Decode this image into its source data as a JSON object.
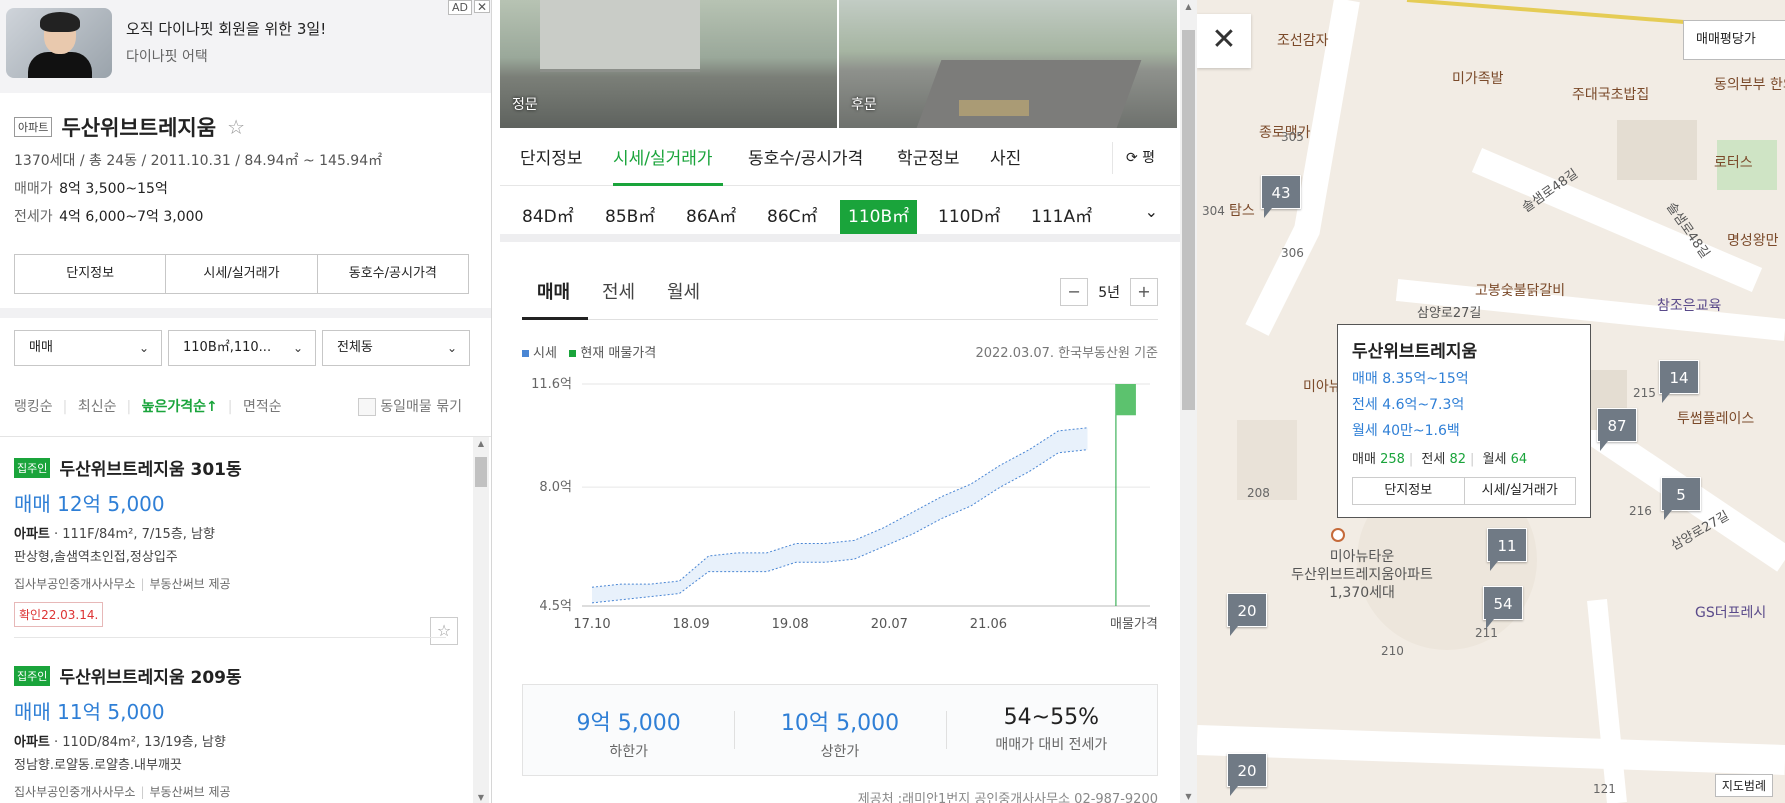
{
  "ad": {
    "badge": "AD",
    "close": "✕",
    "title": "오직 다이나핏 회원을 위한 3일!",
    "subtitle": "다이나핏 어택"
  },
  "complex": {
    "type": "아파트",
    "name": "두산위브트레지움",
    "star": "☆",
    "meta": "1370세대 / 총 24동 / 2011.10.31 / 84.94㎡ ~ 145.94㎡",
    "sale_label": "매매가",
    "sale_value": "8억 3,500~15억",
    "jeonse_label": "전세가",
    "jeonse_value": "4억 6,000~7억 3,000"
  },
  "left_tabs": [
    "단지정보",
    "시세/실거래가",
    "동호수/공시가격"
  ],
  "filters": {
    "trade": "매매",
    "size": "110B㎡,110...",
    "dong": "전체동",
    "chev": "⌄"
  },
  "sorts": {
    "s1": "랭킹순",
    "s2": "최신순",
    "s3": "높은가격순↑",
    "s4": "면적순",
    "same": "동일매물 묶기"
  },
  "listings": [
    {
      "owner": "집주인",
      "name": "두산위브트레지움 301동",
      "price": "매매 12억 5,000",
      "spec_type": "아파트",
      "spec": " · 111F/84m², 7/15층, 남향",
      "desc": "판상형,솔샘역초인접,정상입주",
      "agent": "집사부공인중개사사무소",
      "provider": "부동산써브 제공",
      "confirm": "확인22.03.14.",
      "fav": "☆"
    },
    {
      "owner": "집주인",
      "name": "두산위브트레지움 209동",
      "price": "매매 11억 5,000",
      "spec_type": "아파트",
      "spec": " · 110D/84m², 13/19층, 남향",
      "desc": "정남향.로얄동.로얄층.내부깨끗",
      "agent": "집사부공인중개사사무소",
      "provider": "부동산써브 제공"
    }
  ],
  "photos": {
    "front": "정문",
    "back": "후문"
  },
  "main_tabs": [
    "단지정보",
    "시세/실거래가",
    "동호수/공시가격",
    "학군정보",
    "사진"
  ],
  "pyeong": "평",
  "sizes": [
    "84D㎡",
    "85B㎡",
    "86A㎡",
    "86C㎡",
    "110B㎡",
    "110D㎡",
    "111A㎡"
  ],
  "size_more": "⌄",
  "sub_tabs": [
    "매매",
    "전세",
    "월세"
  ],
  "period": {
    "minus": "−",
    "value": "5년",
    "plus": "+"
  },
  "legend": {
    "a": "시세",
    "b": "현재 매물가격"
  },
  "basis": "2022.03.07. 한국부동산원 기준",
  "colors": {
    "accent": "#1aa43b",
    "blue": "#2f7fd6",
    "band": "#e8f1fb",
    "band_line": "#4a86d4"
  },
  "chart_data": {
    "type": "area",
    "y_ticks": [
      "11.6억",
      "8.0억",
      "4.5억"
    ],
    "ylim": [
      4.5,
      11.6
    ],
    "x_ticks": [
      "17.10",
      "18.09",
      "19.08",
      "20.07",
      "21.06",
      "매물가격"
    ],
    "series": [
      {
        "name": "시세",
        "low": [
          4.6,
          4.7,
          4.8,
          4.9,
          5.6,
          5.6,
          5.6,
          5.9,
          5.9,
          6.0,
          6.4,
          6.8,
          7.3,
          7.7,
          8.3,
          8.8,
          9.4,
          9.5
        ],
        "high": [
          5.1,
          5.2,
          5.2,
          5.3,
          6.1,
          6.2,
          6.2,
          6.5,
          6.5,
          6.6,
          7.0,
          7.5,
          8.0,
          8.4,
          9.0,
          9.5,
          10.1,
          10.2
        ]
      },
      {
        "name": "현재 매물가격",
        "low": 10.6,
        "high": 11.6
      }
    ]
  },
  "summary": [
    {
      "value": "9억 5,000",
      "label": "하한가"
    },
    {
      "value": "10억 5,000",
      "label": "상한가"
    },
    {
      "value": "54~55%",
      "label": "매매가 대비 전세가"
    }
  ],
  "source": "제공처 :래미안1번지 공인중개사사무소 02-987-9200",
  "map": {
    "mode": "매매평당가",
    "close": "✕",
    "pois": [
      "조선감자",
      "미가족발",
      "주대국초밥집",
      "동의부부 한의원",
      "종로맥가",
      "로터스",
      "고봉숯불닭갈비",
      "참조은교육",
      "명성왕만",
      "투썸플레이스",
      "GS더프레시",
      "미아뉴타운",
      "탐스"
    ],
    "roads": [
      "솔샘로48길",
      "솔샘로48길",
      "삼양로27길",
      "삼양로27길"
    ],
    "nums": [
      "305",
      "304",
      "306",
      "208",
      "215",
      "216",
      "210",
      "211",
      "121"
    ],
    "clusters": [
      "43",
      "14",
      "87",
      "5",
      "11",
      "54",
      "20",
      "20"
    ],
    "popup": {
      "title": "두산위브트레지움",
      "sale": "매매 8.35억~15억",
      "jeonse": "전세 4.6억~7.3억",
      "monthly": "월세 40만~1.6백",
      "cnt_sale_l": "매매",
      "cnt_sale": "258",
      "cnt_jeonse_l": "전세",
      "cnt_jeonse": "82",
      "cnt_monthly_l": "월세",
      "cnt_monthly": "64",
      "btn1": "단지정보",
      "btn2": "시세/실거래가"
    },
    "complex_label_1": "미아뉴타운",
    "complex_label_2": "두산위브트레지움아파트",
    "complex_label_3": "1,370세대",
    "scale": "지도범례"
  }
}
